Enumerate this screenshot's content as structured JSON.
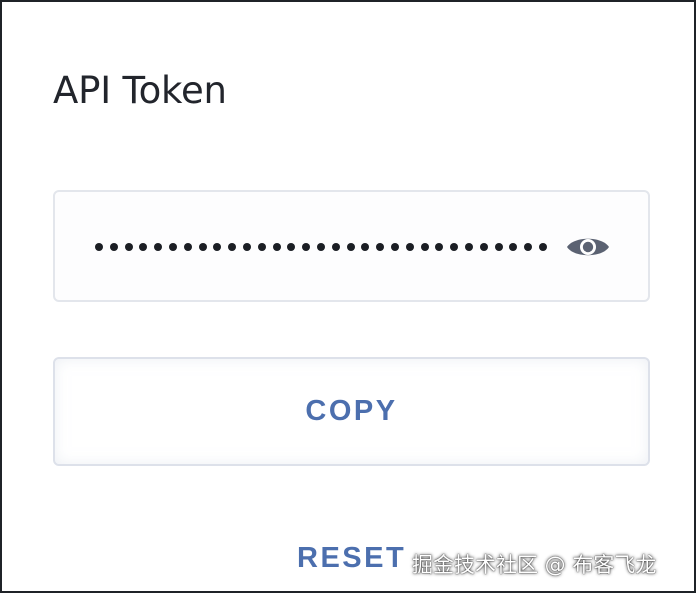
{
  "panel": {
    "title": "API Token"
  },
  "token_field": {
    "masked_length": 31,
    "visibility_icon": "eye-icon"
  },
  "actions": {
    "copy_label": "COPY",
    "reset_label": "RESET"
  },
  "colors": {
    "accent": "#4c6fae",
    "text": "#22252c",
    "border": "#e3e6ec",
    "icon": "#5b6272"
  },
  "watermark": {
    "text": "掘金技术社区 @ 布客飞龙"
  }
}
